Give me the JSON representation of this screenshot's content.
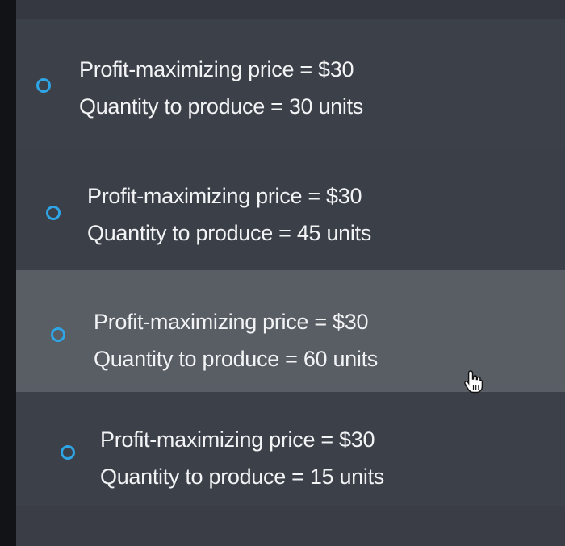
{
  "question": {
    "options": [
      {
        "line1": "Profit-maximizing price = $30",
        "line2": "Quantity to produce = 30 units",
        "selected": false
      },
      {
        "line1": "Profit-maximizing price = $30",
        "line2": "Quantity to produce = 45 units",
        "selected": false
      },
      {
        "line1": "Profit-maximizing price = $30",
        "line2": "Quantity to produce = 60 units",
        "selected": false
      },
      {
        "line1": "Profit-maximizing price = $30",
        "line2": "Quantity to produce = 15 units",
        "selected": false
      }
    ]
  },
  "colors": {
    "panel_bg": "#3c4048",
    "hover_bg": "#595d64",
    "radio_accent": "#2fa5e6",
    "text": "#f2f3f5"
  },
  "icons": {
    "radio": "radio-unselected-icon",
    "cursor": "hand-pointer-icon"
  }
}
